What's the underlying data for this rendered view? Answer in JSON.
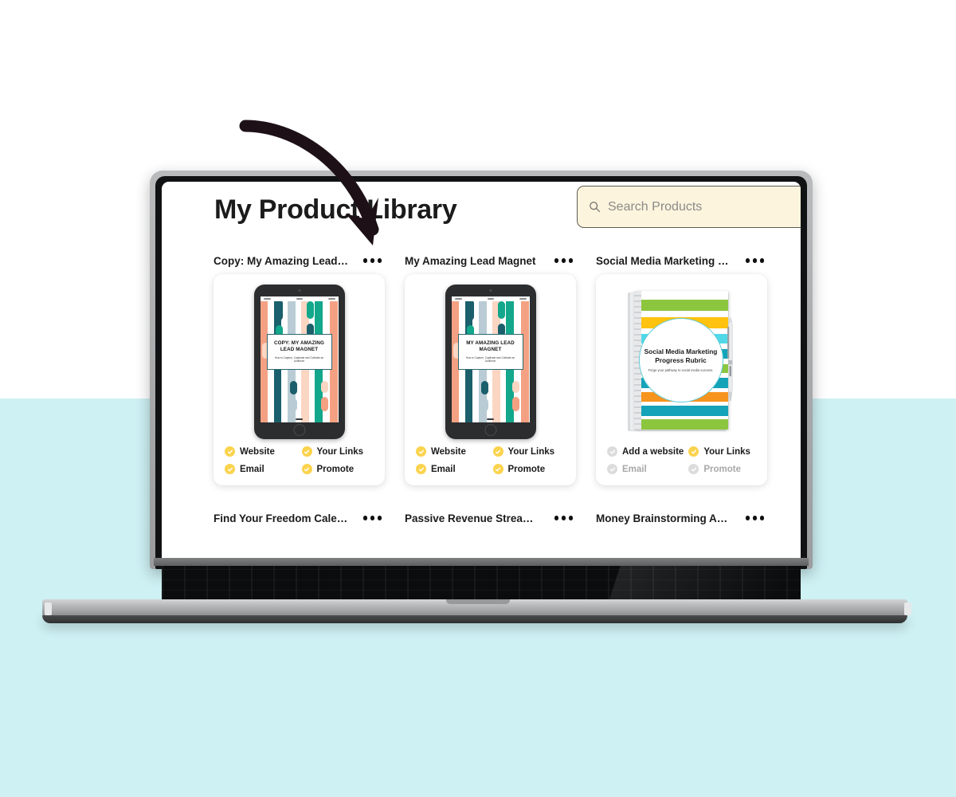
{
  "background": {
    "top_color": "#ffffff",
    "bottom_color": "#cef1f4"
  },
  "header": {
    "title": "My Product Library"
  },
  "search": {
    "placeholder": "Search Products",
    "value": "",
    "icon": "search-icon",
    "bg_color": "#fcf4dd",
    "border_color": "#5d5b52"
  },
  "annotation": {
    "arrow": "curved-down-arrow",
    "color": "#1d1117"
  },
  "menu_icon_label": "more-options",
  "colors": {
    "check_active": "#fcd34d",
    "check_inactive": "#dcdcdc",
    "card_bg": "#ffffff",
    "text": "#1b1b1b",
    "text_muted": "#a8a8a8"
  },
  "products": [
    {
      "title": "Copy: My Amazing Lead M...",
      "thumb": "tablet",
      "cover": {
        "title": "COPY: MY AMAZING LEAD MAGNET",
        "subtitle": "How to Capture, Captivate and Cultivate an Audience"
      },
      "statuses": [
        {
          "label": "Website",
          "done": true
        },
        {
          "label": "Your Links",
          "done": true
        },
        {
          "label": "Email",
          "done": true
        },
        {
          "label": "Promote",
          "done": true
        }
      ]
    },
    {
      "title": "My Amazing Lead Magnet",
      "thumb": "tablet",
      "cover": {
        "title": "MY AMAZING LEAD MAGNET",
        "subtitle": "How to Capture, Captivate and Cultivate an Audience"
      },
      "statuses": [
        {
          "label": "Website",
          "done": true
        },
        {
          "label": "Your Links",
          "done": true
        },
        {
          "label": "Email",
          "done": true
        },
        {
          "label": "Promote",
          "done": true
        }
      ]
    },
    {
      "title": "Social Media Marketing Pr...",
      "thumb": "notebook",
      "cover": {
        "title": "Social Media Marketing Progress Rubric",
        "subtitle": "Forge your pathway to social media success."
      },
      "statuses": [
        {
          "label": "Add a website",
          "done": false
        },
        {
          "label": "Your Links",
          "done": true
        },
        {
          "label": "Email",
          "done": false
        },
        {
          "label": "Promote",
          "done": false
        }
      ]
    }
  ],
  "products_bottom_row": [
    {
      "title": "Find Your Freedom Calend..."
    },
    {
      "title": "Passive Revenue Streams ..."
    },
    {
      "title": "Money Brainstorming Age..."
    }
  ],
  "tablet_palette": {
    "peach": "#f4a183",
    "dark_teal": "#1a5f6b",
    "light_blue": "#b9ccd5",
    "light_peach": "#fbd6c3",
    "green_teal": "#13a78b",
    "white": "#ffffff"
  },
  "notebook_palette": {
    "green": "#8cc63f",
    "yellow": "#ffc20e",
    "cyan": "#4fd9e8",
    "teal": "#14a3b8",
    "orange": "#f7941e",
    "white": "#ffffff"
  }
}
